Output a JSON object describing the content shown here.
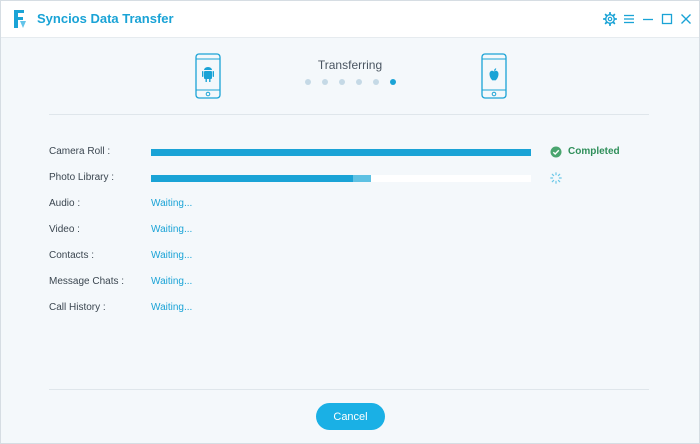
{
  "app": {
    "title": "Syncios Data Transfer",
    "accent_color": "#1aa3d6",
    "icons": {
      "logo": "syncios-logo-icon",
      "settings": "gear-icon",
      "menu": "menu-icon",
      "minimize": "minimize-icon",
      "maximize": "maximize-icon",
      "close": "close-icon"
    }
  },
  "header": {
    "status": "Transferring",
    "source_device_icon": "android-phone-icon",
    "target_device_icon": "iphone-icon",
    "progress_step": 6,
    "progress_steps_total": 6
  },
  "items": [
    {
      "label": "Camera Roll :",
      "state": "completed",
      "progress": 1.0,
      "status_text": "Completed",
      "status_icon": "check-circle-icon"
    },
    {
      "label": "Photo Library :",
      "state": "in-progress",
      "progress": 0.58,
      "status_icon": "spinner-icon"
    },
    {
      "label": "Audio :",
      "state": "waiting",
      "status_text": "Waiting..."
    },
    {
      "label": "Video :",
      "state": "waiting",
      "status_text": "Waiting..."
    },
    {
      "label": "Contacts :",
      "state": "waiting",
      "status_text": "Waiting..."
    },
    {
      "label": "Message Chats :",
      "state": "waiting",
      "status_text": "Waiting..."
    },
    {
      "label": "Call History :",
      "state": "waiting",
      "status_text": "Waiting..."
    }
  ],
  "footer": {
    "cancel_label": "Cancel"
  }
}
